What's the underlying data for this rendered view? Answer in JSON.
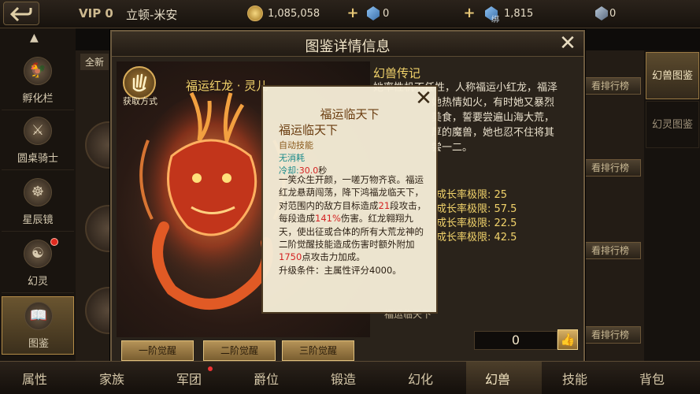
{
  "top": {
    "vip": "VIP 0",
    "player_name": "立顿-米安",
    "gold": "1,085,058",
    "gems": "0",
    "bound_label": "绑",
    "bound_gems": "1,815",
    "other": "0"
  },
  "sidebar": {
    "items": [
      {
        "label": "孵化栏",
        "icon": "rooster-icon"
      },
      {
        "label": "圆桌骑士",
        "icon": "crossed-swords-icon"
      },
      {
        "label": "星辰镜",
        "icon": "mirror-icon"
      },
      {
        "label": "幻灵",
        "icon": "spirit-mask-icon"
      },
      {
        "label": "图鉴",
        "icon": "book-icon"
      }
    ]
  },
  "background": {
    "tab_partial": "全新",
    "rank_label": "看排行榜"
  },
  "right_tabs": [
    "幻兽图鉴",
    "幻灵图鉴"
  ],
  "modal": {
    "title": "图鉴详情信息",
    "get_label": "获取方式",
    "pet_name": "福运红龙 · 灵儿",
    "lore_title": "幻兽传记",
    "lore_lines": [
      "她率性机不任性，人称福运小红龙，福泽",
      "她热情如火，有时她又暴烈",
      "美食，誓要尝遍山海大荒，",
      "厚的魔兽，她也忍不住将其",
      "尝一二。"
    ],
    "growth": [
      "成长率极限: 25",
      "成长率极限: 57.5",
      "成长率极限: 22.5",
      "成长率极限: 42.5"
    ],
    "skill_bottom": "福运临天下",
    "awaken_buttons": [
      "一阶觉醒",
      "二阶觉醒",
      "三阶觉醒"
    ],
    "like_count": "0"
  },
  "tooltip": {
    "title": "福运临天下",
    "skill_name": "福运临天下",
    "type": "自动技能",
    "cost": "无消耗",
    "cooldown_label": "冷却:",
    "cooldown_value": "30.0",
    "cooldown_unit": "秒",
    "desc_1": "一笑众生开颜，一嗟万物齐哀。福运红龙悬葫闯荡，降下鸿福龙临天下，对范围内的敌方目标造成",
    "segments": "21",
    "desc_2": "段攻击，每段造成",
    "percent": "141%",
    "desc_3": "伤害。红龙翱翔九天，使出征或合体的所有大荒龙神的二阶觉醒技能造成伤害时额外附加",
    "bonus": "1750",
    "desc_4": "点攻击力加成。",
    "upgrade": "升级条件：主属性评分4000。"
  },
  "bottom_nav": [
    "属性",
    "家族",
    "军团",
    "爵位",
    "锻造",
    "幻化",
    "幻兽",
    "技能",
    "背包"
  ],
  "colors": {
    "accent_gold": "#f2d36b",
    "highlight_red": "#d42323",
    "panel_bg": "#2a231b"
  }
}
